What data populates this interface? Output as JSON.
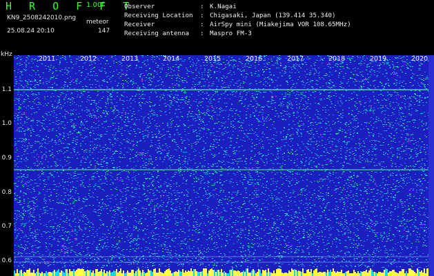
{
  "header": {
    "brand": "H R O F F T",
    "version": "1.00f",
    "file": "KN9_2508242010.png",
    "mode": "meteor",
    "timestamp": "25.08.24 20:10",
    "count": "147"
  },
  "meta": [
    {
      "key": "Observer",
      "value": "K.Nagai"
    },
    {
      "key": "Receiving Location",
      "value": "Chigasaki, Japan (139.414 35.340)"
    },
    {
      "key": "Receiver",
      "value": "AirSpy mini (Miakejima VOR 108.65MHz)"
    },
    {
      "key": "Receiving antenna",
      "value": "Maspro FM-3"
    }
  ],
  "axis": {
    "unit": "kHz",
    "ticks": [
      "1.1",
      "1.0",
      "0.9",
      "0.8",
      "0.7",
      "0.6"
    ],
    "years": [
      "2011",
      "2012",
      "2013",
      "2014",
      "2015",
      "2016",
      "2017",
      "2018",
      "2019",
      "2020"
    ]
  },
  "colors": {
    "background": "#000000",
    "plot": "#1c1fbf",
    "noise_cyan": "#19d6e6",
    "noise_green": "#2fe37a",
    "signal": "#4dff88",
    "footer": "#ffff44"
  }
}
